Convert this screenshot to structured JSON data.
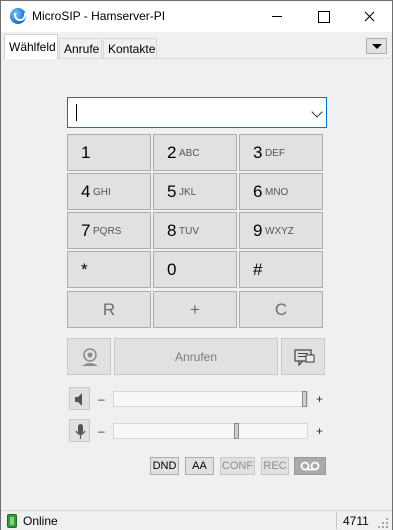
{
  "window": {
    "title": "MicroSIP - Hamserver-PI"
  },
  "tabs": [
    {
      "label": "Wählfeld",
      "active": true
    },
    {
      "label": "Anrufe",
      "active": false
    },
    {
      "label": "Kontakte",
      "active": false
    }
  ],
  "dialer": {
    "number_value": "",
    "keys": [
      {
        "digit": "1",
        "letters": ""
      },
      {
        "digit": "2",
        "letters": "ABC"
      },
      {
        "digit": "3",
        "letters": "DEF"
      },
      {
        "digit": "4",
        "letters": "GHI"
      },
      {
        "digit": "5",
        "letters": "JKL"
      },
      {
        "digit": "6",
        "letters": "MNO"
      },
      {
        "digit": "7",
        "letters": "PQRS"
      },
      {
        "digit": "8",
        "letters": "TUV"
      },
      {
        "digit": "9",
        "letters": "WXYZ"
      },
      {
        "digit": "*",
        "letters": ""
      },
      {
        "digit": "0",
        "letters": ""
      },
      {
        "digit": "#",
        "letters": ""
      },
      {
        "digit": "R",
        "letters": ""
      },
      {
        "digit": "+",
        "letters": ""
      },
      {
        "digit": "C",
        "letters": ""
      }
    ],
    "call_label": "Anrufen"
  },
  "sliders": {
    "speaker": {
      "minus": "–",
      "plus": "+",
      "level": 1.0
    },
    "microphone": {
      "minus": "–",
      "plus": "+",
      "level": 0.64
    }
  },
  "toggles": [
    {
      "label": "DND",
      "enabled": true
    },
    {
      "label": "AA",
      "enabled": true
    },
    {
      "label": "CONF",
      "enabled": false
    },
    {
      "label": "REC",
      "enabled": false
    }
  ],
  "statusbar": {
    "status": "Online",
    "extension": "4711",
    "status_color": "#2f9c2f"
  }
}
